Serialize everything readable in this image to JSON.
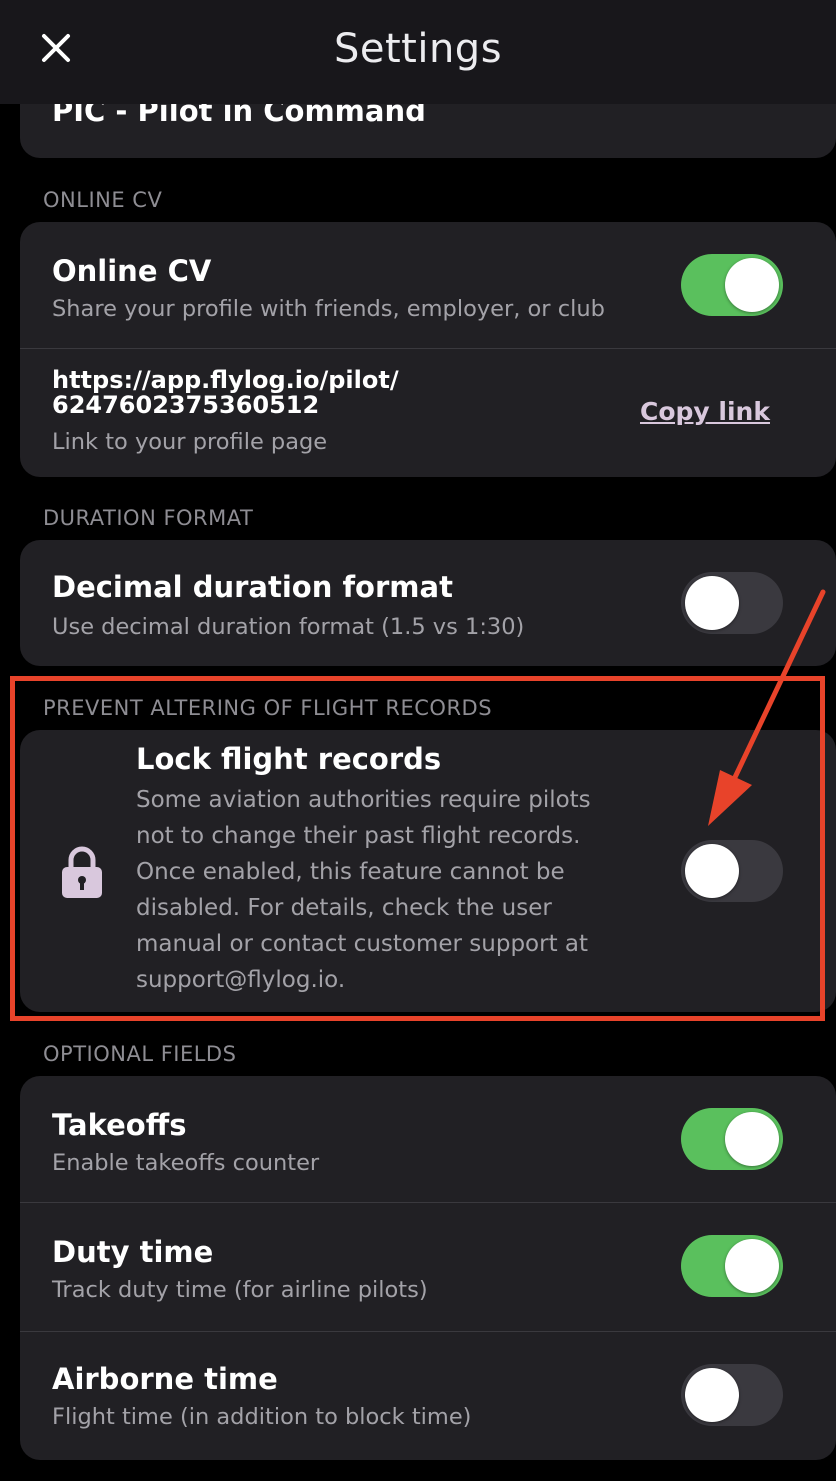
{
  "header": {
    "title": "Settings"
  },
  "pilot_role": {
    "label": "PIC - Pilot in Command"
  },
  "online_cv": {
    "section": "ONLINE CV",
    "title": "Online CV",
    "subtitle": "Share your profile with friends, employer, or club",
    "enabled": true,
    "url_line1": "https://app.flylog.io/pilot/",
    "url_line2": "6247602375360512",
    "url_caption": "Link to your profile page",
    "copy_link": "Copy link"
  },
  "duration_format": {
    "section": "DURATION FORMAT",
    "title": "Decimal duration format",
    "subtitle": "Use decimal duration format (1.5 vs 1:30)",
    "enabled": false
  },
  "lock_records": {
    "section": "PREVENT ALTERING OF FLIGHT RECORDS",
    "title": "Lock flight records",
    "lines": [
      "Some aviation authorities require pilots",
      "not to change their past flight records.",
      "Once enabled, this feature cannot be",
      "disabled. For details, check the user",
      "manual or contact customer support at",
      "support@flylog.io."
    ],
    "enabled": false
  },
  "optional_fields": {
    "section": "OPTIONAL FIELDS",
    "items": [
      {
        "title": "Takeoffs",
        "subtitle": "Enable takeoffs counter",
        "enabled": true
      },
      {
        "title": "Duty time",
        "subtitle": "Track duty time (for airline pilots)",
        "enabled": true
      },
      {
        "title": "Airborne time",
        "subtitle": "Flight time (in addition to block time)",
        "enabled": false
      }
    ]
  },
  "colors": {
    "toggle_on": "#5ac05d",
    "toggle_off": "#3a393f",
    "highlight": "#e8432a",
    "lock_icon": "#d9c8dd"
  },
  "icons": [
    "close-icon",
    "lock-icon"
  ]
}
